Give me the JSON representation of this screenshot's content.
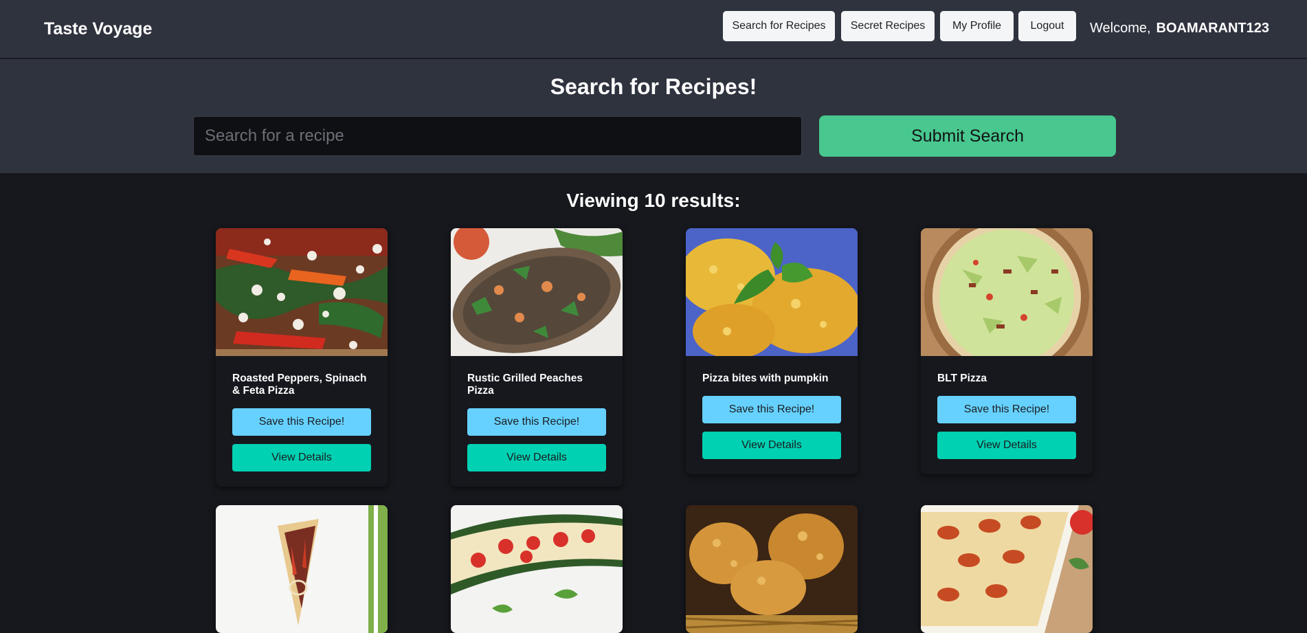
{
  "nav": {
    "brand": "Taste Voyage",
    "buttons": [
      "Search for Recipes",
      "Secret Recipes",
      "My Profile",
      "Logout"
    ],
    "welcome": "Welcome,",
    "username": "BOAMARANT123"
  },
  "search": {
    "title": "Search for Recipes!",
    "placeholder": "Search for a recipe",
    "submit_label": "Submit Search"
  },
  "results": {
    "title": "Viewing 10 results:",
    "save_label": "Save this Recipe!",
    "details_label": "View Details",
    "cards": [
      {
        "title": "Roasted Peppers, Spinach & Feta Pizza"
      },
      {
        "title": "Rustic Grilled Peaches Pizza"
      },
      {
        "title": "Pizza bites with pumpkin"
      },
      {
        "title": "BLT Pizza"
      },
      {
        "title": ""
      },
      {
        "title": ""
      },
      {
        "title": ""
      },
      {
        "title": ""
      }
    ]
  },
  "colors": {
    "nav_bg": "#2f333e",
    "page_bg": "#16181d",
    "submit": "#48c78e",
    "save": "#66d1ff",
    "details": "#00d1b2"
  }
}
